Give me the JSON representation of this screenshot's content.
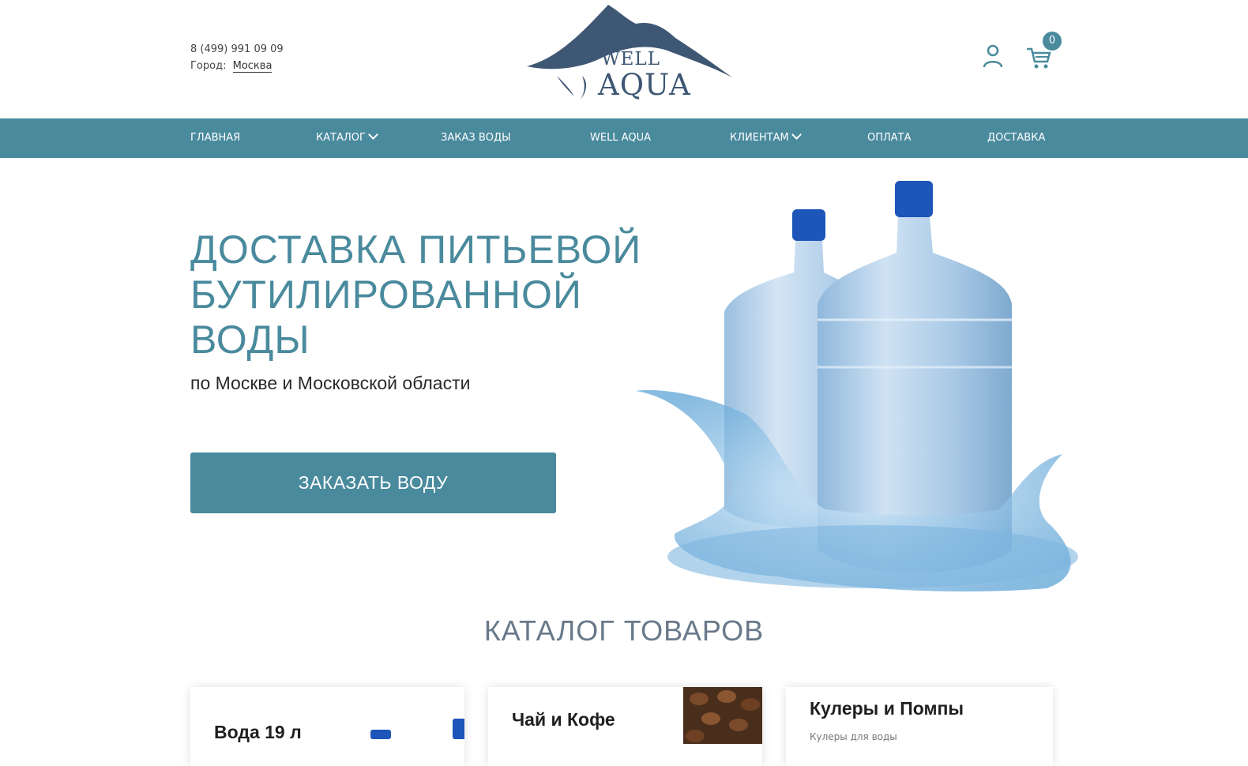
{
  "header": {
    "phone": "8 (499) 991 09 09",
    "city_label": "Город:",
    "city_value": "Москва",
    "logo_well": "WELL",
    "logo_aqua": "AQUA",
    "cart_count": "0"
  },
  "nav": {
    "items": [
      {
        "label": "ГЛАВНАЯ"
      },
      {
        "label": "КАТАЛОГ"
      },
      {
        "label": "ЗАКАЗ ВОДЫ"
      },
      {
        "label": "WELL AQUA"
      },
      {
        "label": "КЛИЕНТАМ"
      },
      {
        "label": "ОПЛАТА"
      },
      {
        "label": "ДОСТАВКА"
      }
    ]
  },
  "hero": {
    "title_line1": "ДОСТАВКА ПИТЬЕВОЙ",
    "title_line2": "БУТИЛИРОВАННОЙ",
    "title_line3": "ВОДЫ",
    "subtitle": "по Москве и Московской области",
    "cta_label": "ЗАКАЗАТЬ ВОДУ"
  },
  "catalog": {
    "title": "КАТАЛОГ ТОВАРОВ",
    "cards": [
      {
        "title": "Вода 19 л"
      },
      {
        "title": "Чай и Кофе"
      },
      {
        "title": "Кулеры и Помпы",
        "subtitle": "Кулеры для воды"
      }
    ]
  },
  "colors": {
    "accent": "#4a8a9d",
    "logo": "#3e5774",
    "catalog_title": "#68798a"
  }
}
